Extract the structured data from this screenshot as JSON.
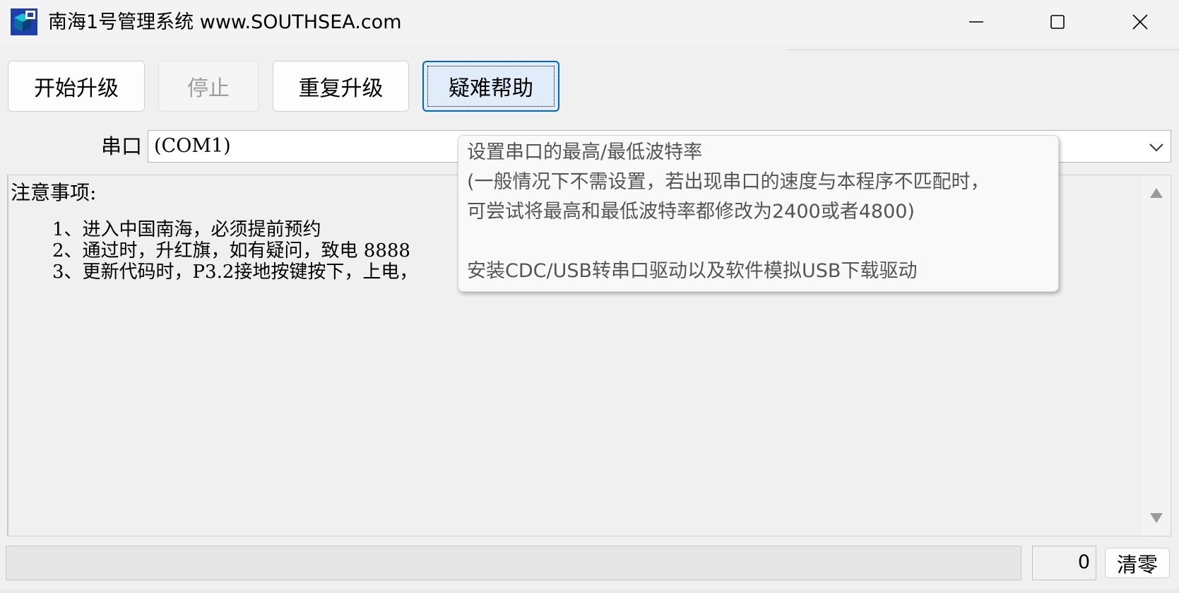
{
  "window": {
    "title": "南海1号管理系统  www.SOUTHSEA.com"
  },
  "toolbar": {
    "start_upgrade": "开始升级",
    "stop": "停止",
    "repeat_upgrade": "重复升级",
    "help": "疑难帮助"
  },
  "port": {
    "label": "串口",
    "value": "(COM1)"
  },
  "notes": {
    "heading": "注意事项:",
    "lines": [
      "1、进入中国南海，必须提前预约",
      "2、通过时，升红旗，如有疑问，致电 8888",
      "3、更新代码时，P3.2接地按键按下，上电，"
    ]
  },
  "tooltip": {
    "lines": [
      "设置串口的最高/最低波特率",
      "(一般情况下不需设置，若出现串口的速度与本程序不匹配时，",
      "可尝试将最高和最低波特率都修改为2400或者4800)",
      "",
      "安装CDC/USB转串口驱动以及软件模拟USB下载驱动"
    ]
  },
  "footer": {
    "counter": "0",
    "clear": "清零"
  },
  "icons": {
    "app": "app-cube-icon",
    "minimize": "minimize-icon",
    "maximize": "maximize-icon",
    "close": "close-icon",
    "dropdown": "chevron-down-icon",
    "scroll_up": "scroll-up-icon",
    "scroll_down": "scroll-down-icon"
  },
  "colors": {
    "focus_border": "#0067c0",
    "focus_fill": "#e1ecfa",
    "app_icon_blue": "#1f3fae",
    "app_icon_cyan": "#18c3d8"
  }
}
